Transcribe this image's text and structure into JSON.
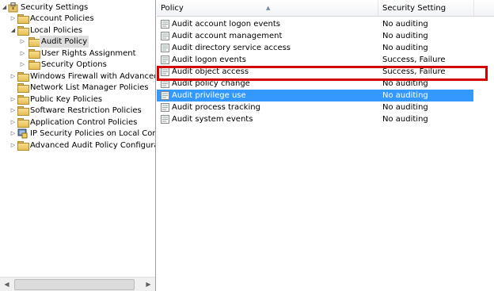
{
  "tree": {
    "items": [
      {
        "label": "Security Settings",
        "icon": "shield-icon",
        "expander": "expanded"
      },
      {
        "label": "Account Policies",
        "icon": "folder-icon",
        "expander": "collapsed"
      },
      {
        "label": "Local Policies",
        "icon": "folder-icon",
        "expander": "expanded"
      },
      {
        "label": "Audit Policy",
        "icon": "folder-icon",
        "expander": "collapsed",
        "selected": true
      },
      {
        "label": "User Rights Assignment",
        "icon": "folder-icon",
        "expander": "collapsed"
      },
      {
        "label": "Security Options",
        "icon": "folder-icon",
        "expander": "collapsed"
      },
      {
        "label": "Windows Firewall with Advanced Sec",
        "icon": "folder-icon",
        "expander": "collapsed"
      },
      {
        "label": "Network List Manager Policies",
        "icon": "folder-icon",
        "expander": "none"
      },
      {
        "label": "Public Key Policies",
        "icon": "folder-icon",
        "expander": "collapsed"
      },
      {
        "label": "Software Restriction Policies",
        "icon": "folder-icon",
        "expander": "collapsed"
      },
      {
        "label": "Application Control Policies",
        "icon": "folder-icon",
        "expander": "collapsed"
      },
      {
        "label": "IP Security Policies on Local Compute",
        "icon": "ip-security-icon",
        "expander": "collapsed"
      },
      {
        "label": "Advanced Audit Policy Configuration",
        "icon": "folder-icon",
        "expander": "collapsed"
      }
    ]
  },
  "list": {
    "columns": {
      "policy": "Policy",
      "setting": "Security Setting"
    },
    "rows": [
      {
        "policy": "Audit account logon events",
        "setting": "No auditing"
      },
      {
        "policy": "Audit account management",
        "setting": "No auditing"
      },
      {
        "policy": "Audit directory service access",
        "setting": "No auditing"
      },
      {
        "policy": "Audit logon events",
        "setting": "Success, Failure"
      },
      {
        "policy": "Audit object access",
        "setting": "Success, Failure",
        "boxed": true
      },
      {
        "policy": "Audit policy change",
        "setting": "No auditing"
      },
      {
        "policy": "Audit privilege use",
        "setting": "No auditing",
        "highlighted": true
      },
      {
        "policy": "Audit process tracking",
        "setting": "No auditing"
      },
      {
        "policy": "Audit system events",
        "setting": "No auditing"
      }
    ]
  },
  "colors": {
    "highlight": "#3399ff",
    "annotation_box": "#d40000"
  }
}
